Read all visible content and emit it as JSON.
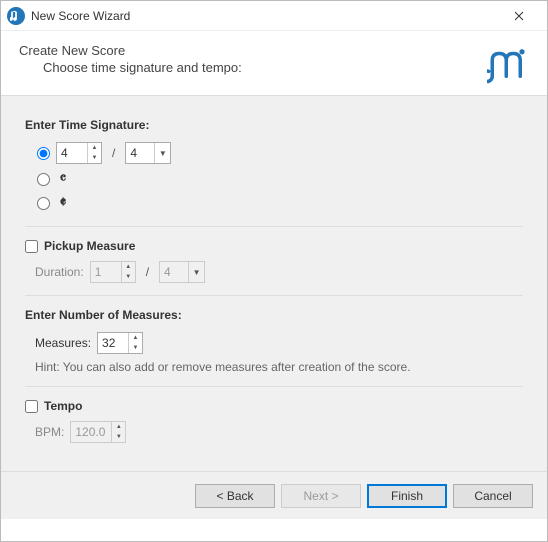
{
  "window": {
    "title": "New Score Wizard"
  },
  "header": {
    "title": "Create New Score",
    "subtitle": "Choose time signature and tempo:"
  },
  "timesig": {
    "label": "Enter Time Signature:",
    "numerator": "4",
    "denominator": "4"
  },
  "pickup": {
    "label": "Pickup Measure",
    "duration_label": "Duration:",
    "numerator": "1",
    "denominator": "4"
  },
  "measures": {
    "label": "Enter Number of Measures:",
    "field_label": "Measures:",
    "value": "32",
    "hint": "Hint: You can also add or remove measures after creation of the score."
  },
  "tempo": {
    "label": "Tempo",
    "field_label": "BPM:",
    "value": "120.0"
  },
  "buttons": {
    "back": "< Back",
    "next": "Next >",
    "finish": "Finish",
    "cancel": "Cancel"
  }
}
